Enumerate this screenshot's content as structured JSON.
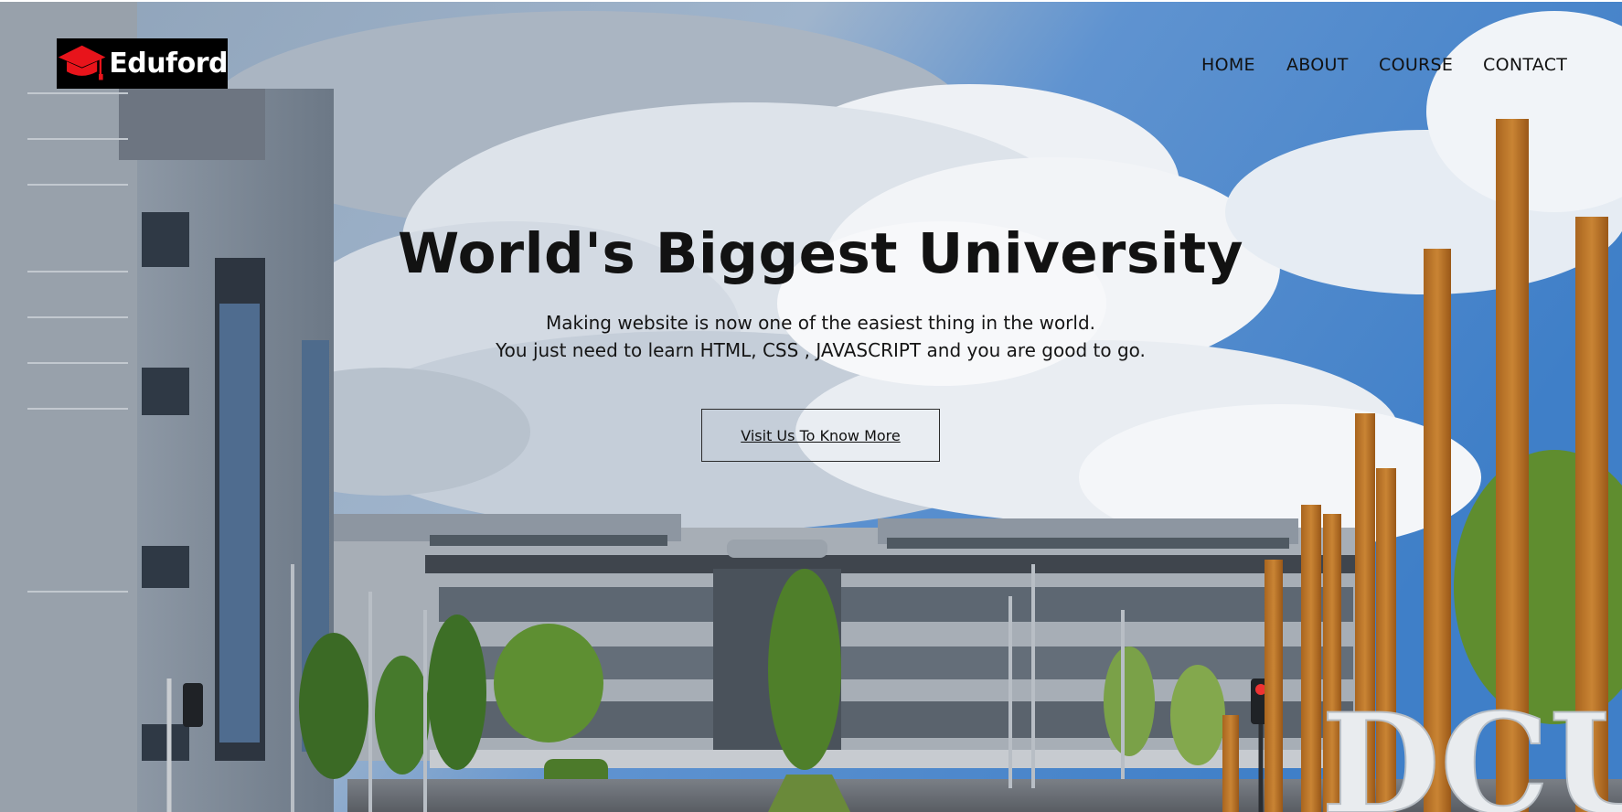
{
  "brand": {
    "name": "Eduford",
    "logo_icon": "graduation-cap-icon",
    "logo_color": "#e8141b"
  },
  "nav": {
    "items": [
      {
        "label": "HOME"
      },
      {
        "label": "ABOUT"
      },
      {
        "label": "COURSE"
      },
      {
        "label": "CONTACT"
      }
    ]
  },
  "hero": {
    "title": "World's Biggest University",
    "subtitle_line1": "Making website is now one of the easiest thing in the world.",
    "subtitle_line2": "You just need to learn HTML, CSS , JAVASCRIPT and you are good to go.",
    "cta_label": "Visit Us To Know More",
    "background_sign": "DCU"
  },
  "colors": {
    "sky": "#4a86c8",
    "accent": "#e8141b",
    "text": "#121212"
  }
}
